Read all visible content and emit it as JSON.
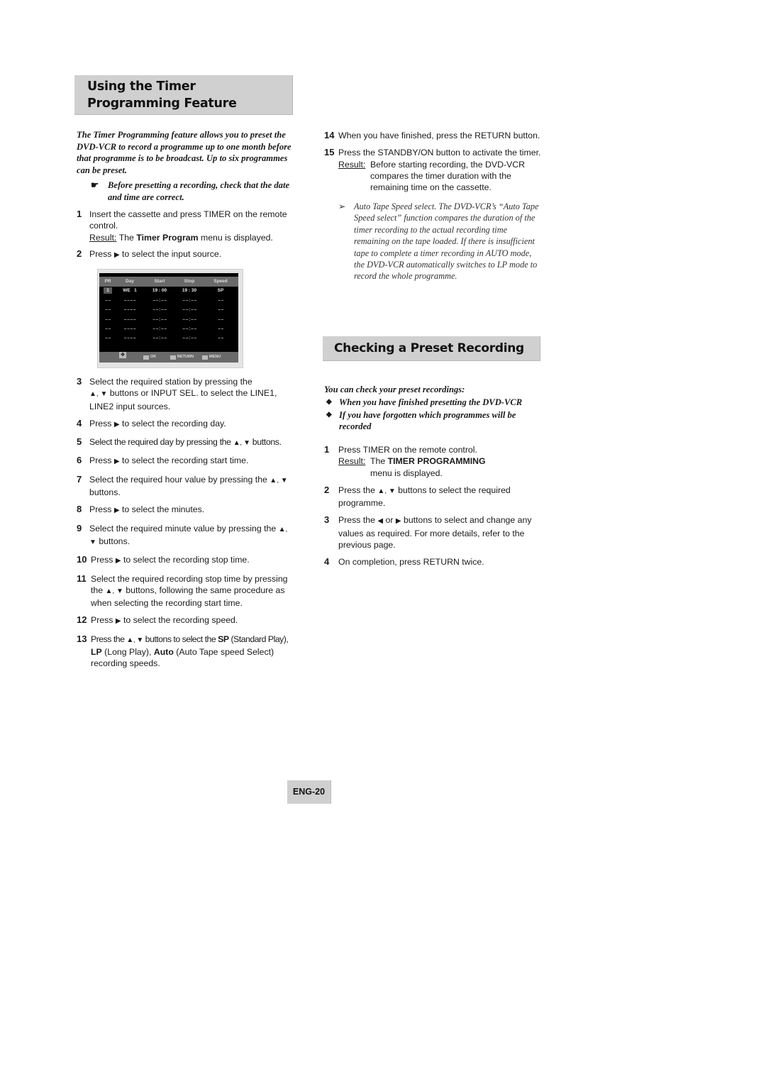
{
  "left": {
    "title": "Using the Timer Programming Feature",
    "intro": "The Timer Programming feature allows you to preset the DVD-VCR to record a programme up to one month before that programme is to be broadcast. Up to six programmes can be preset.",
    "note_icon": "pointing-hand-icon",
    "note": "Before presetting a recording, check that the date and time are correct.",
    "steps_a": [
      {
        "num": "1",
        "text": "Insert the cassette and press TIMER on the remote control.",
        "result_label": "Result:",
        "result_pre": "The ",
        "result_bold": "Timer Program",
        "result_post": " menu is displayed."
      },
      {
        "num": "2",
        "text_pre": "Press ",
        "text_post": " to select the input source."
      }
    ],
    "osd": {
      "headers": [
        "PR",
        "Day",
        "Start",
        "Stop",
        "Speed"
      ],
      "selected_row": {
        "pr": "1",
        "day": "WE   1",
        "start": "19 : 00",
        "stop": "19 : 30",
        "speed": "SP"
      },
      "empty_row": {
        "pr": "– –",
        "day": "– –  – –",
        "start": "– – : – –",
        "stop": "– – : – –",
        "speed": "– –"
      },
      "footer": {
        "ok": "OK",
        "return": "RETURN",
        "menu": "MENU"
      }
    },
    "steps_b": [
      {
        "num": "3",
        "line1": "Select the required station by pressing the",
        "line2": " buttons or INPUT SEL. to select the LINE1, LINE2 input sources."
      },
      {
        "num": "4",
        "pre": "Press ",
        "post": " to select the recording day."
      },
      {
        "num": "5",
        "pre": "Select the required day by pressing the ",
        "post": " buttons."
      },
      {
        "num": "6",
        "pre": "Press ",
        "post": " to select the recording start time."
      },
      {
        "num": "7",
        "pre": "Select the required hour value by pressing the ",
        "post": " buttons."
      },
      {
        "num": "8",
        "pre": "Press ",
        "post": " to select the minutes."
      },
      {
        "num": "9",
        "pre": "Select the required minute value by pressing the ",
        "post": " buttons."
      },
      {
        "num": "10",
        "pre": "Press ",
        "post": " to select the recording stop time."
      },
      {
        "num": "11",
        "pre": "Select the required recording stop time by pressing the ",
        "post": " buttons, following the same procedure as when selecting the recording start time."
      },
      {
        "num": "12",
        "pre": "Press ",
        "post": " to select the recording speed."
      },
      {
        "num": "13",
        "pre": "Press the ",
        "mid": " buttons to select the ",
        "sp": "SP",
        "sp_desc": " (Standard Play), ",
        "lp": "LP",
        "lp_desc": " (Long Play), ",
        "auto": "Auto",
        "auto_desc": " (Auto Tape speed Select) recording speeds."
      }
    ]
  },
  "right": {
    "steps_a": [
      {
        "num": "14",
        "text": "When you have finished, press the RETURN button."
      },
      {
        "num": "15",
        "text": "Press the STANDBY/ON button to activate the timer.",
        "result_label": "Result:",
        "result": "Before starting recording, the DVD-VCR compares the timer duration with the remaining time on the cassette."
      }
    ],
    "tip_icon": "arrow-bullet-icon",
    "tip": "Auto Tape Speed select. The DVD-VCR’s “Auto Tape Speed select” function compares the duration of the timer recording to the actual recording time remaining on the tape loaded. If there is insufficient tape to complete a timer recording in AUTO mode, the DVD-VCR automatically switches to LP mode to record the whole programme.",
    "title": "Checking a Preset Recording",
    "intro": "You can check your preset recordings:",
    "bullets": [
      "When you have finished presetting the DVD-VCR",
      "If you have forgotten which programmes will be recorded"
    ],
    "steps": [
      {
        "num": "1",
        "text": "Press TIMER on the remote control.",
        "result_label": "Result:",
        "result_pre": "The ",
        "result_bold": "TIMER PROGRAMMING",
        "result_post": " menu is displayed."
      },
      {
        "num": "2",
        "pre": "Press the ",
        "post": " buttons to select the required programme."
      },
      {
        "num": "3",
        "pre": "Press the ",
        "mid": " or ",
        "post": " buttons to select and change any values as required. For more details, refer to the previous page."
      },
      {
        "num": "4",
        "text": "On completion, press RETURN twice."
      }
    ]
  },
  "footer": {
    "page": "ENG-20"
  }
}
